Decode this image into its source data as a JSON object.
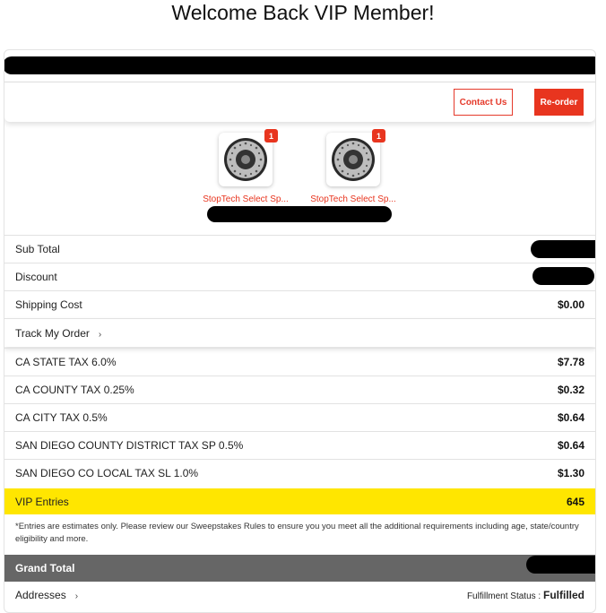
{
  "page": {
    "title": "Welcome Back VIP Member!"
  },
  "header": {
    "contact_label": "Contact Us",
    "reorder_label": "Re-order"
  },
  "products": [
    {
      "name": "StopTech Select Sp...",
      "quantity": "1"
    },
    {
      "name": "StopTech Select Sp...",
      "quantity": "1"
    }
  ],
  "summary": {
    "subtotal_label": "Sub Total",
    "discount_label": "Discount",
    "shipping_label": "Shipping Cost",
    "shipping_value": "$0.00",
    "track_label": "Track My Order",
    "taxes": [
      {
        "label": "CA STATE TAX 6.0%",
        "value": "$7.78"
      },
      {
        "label": "CA COUNTY TAX 0.25%",
        "value": "$0.32"
      },
      {
        "label": "CA CITY TAX 0.5%",
        "value": "$0.64"
      },
      {
        "label": "SAN DIEGO COUNTY DISTRICT TAX SP 0.5%",
        "value": "$0.64"
      },
      {
        "label": "SAN DIEGO CO LOCAL TAX SL 1.0%",
        "value": "$1.30"
      }
    ],
    "vip_label": "VIP Entries",
    "vip_value": "645",
    "disclaimer": "*Entries are estimates only. Please review our Sweepstakes Rules to ensure you you meet all the additional requirements including age, state/country eligibility and more.",
    "grand_total_label": "Grand Total"
  },
  "footer": {
    "addresses_label": "Addresses",
    "status_label": "Fulfillment Status :",
    "status_value": "Fulfilled"
  },
  "colors": {
    "accent": "#e8351f",
    "vip_highlight": "#ffe600",
    "grand_total_bg": "#666666"
  }
}
